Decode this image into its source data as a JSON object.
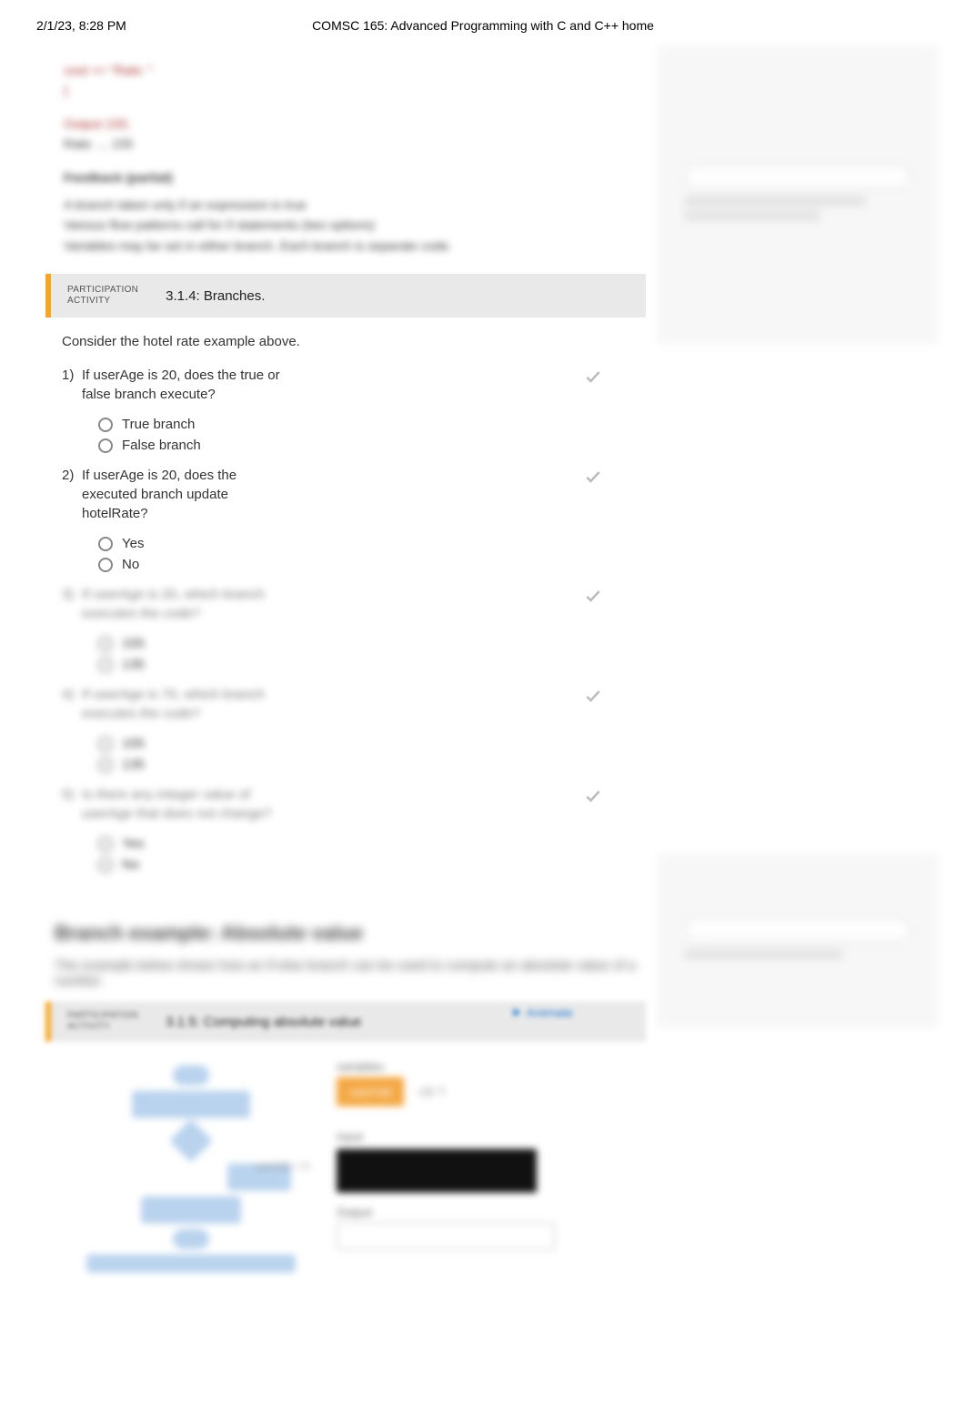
{
  "header": {
    "timestamp": "2/1/23, 8:28 PM",
    "title": "COMSC 165: Advanced Programming with C and C++ home"
  },
  "code_blur": {
    "l1": "cout << \"Rate: \"",
    "l2": "}",
    "l3": "Output 155;",
    "l4": "Rate: ... 155",
    "l5": "Feedback (partial)",
    "l6": "A branch taken only if an expression is true",
    "l7": "Various flow patterns call for if statements (two options)",
    "l8": "Variables may be set in either branch. Each branch is separate code."
  },
  "activity": {
    "label1": "PARTICIPATION",
    "label2": "ACTIVITY",
    "title": "3.1.4: Branches."
  },
  "intro": "Consider the hotel rate example above.",
  "questions": [
    {
      "num": "1)",
      "text": "If userAge is 20, does the true or false branch execute?",
      "opts": [
        "True branch",
        "False branch"
      ]
    },
    {
      "num": "2)",
      "text": "If userAge is 20, does the executed branch update hotelRate?",
      "opts": [
        "Yes",
        "No"
      ]
    },
    {
      "num": "3)",
      "text": "If userAge is 20, which branch executes the code?",
      "opts": [
        "155",
        "135"
      ]
    },
    {
      "num": "4)",
      "text": "If userAge is 70, which branch executes the code?",
      "opts": [
        "155",
        "135"
      ]
    },
    {
      "num": "5)",
      "text": "Is there any integer value of userAge that does not change?",
      "opts": [
        "Yes",
        "No"
      ]
    }
  ],
  "section2": {
    "title": "Branch example: Absolute value",
    "para": "The example below shows how an if-else branch can be used to compute an absolute value of a number."
  },
  "anim": {
    "label1": "PARTICIPATION",
    "label2": "ACTIVITY",
    "title": "3.1.5: Computing absolute value",
    "play": "Animate"
  },
  "io": {
    "variables_label": "variables",
    "var_box": "userVal",
    "var_side": "-15  ?",
    "input_label": "Input",
    "output_label": "Output"
  }
}
